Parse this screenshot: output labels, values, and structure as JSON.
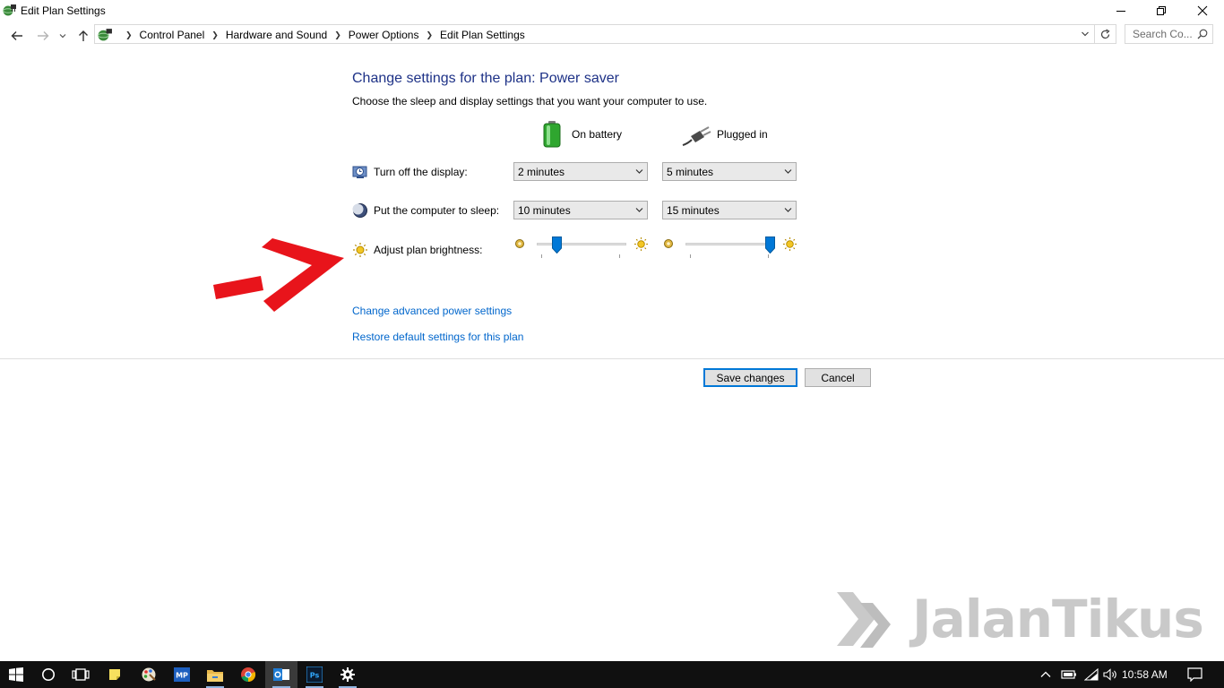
{
  "window": {
    "title": "Edit Plan Settings",
    "icon": "power-options-icon"
  },
  "window_controls": [
    "minimize-icon",
    "restore-icon",
    "close-icon"
  ],
  "navigation": {
    "buttons": [
      "back-arrow-icon",
      "forward-arrow-icon",
      "recent-dropdown-icon",
      "up-arrow-icon"
    ],
    "breadcrumb": [
      "Control Panel",
      "Hardware and Sound",
      "Power Options",
      "Edit Plan Settings"
    ],
    "search_placeholder": "Search Co..."
  },
  "content": {
    "heading": "Change settings for the plan: Power saver",
    "subheading": "Choose the sleep and display settings that you want your computer to use.",
    "columns": {
      "on_battery": "On battery",
      "plugged_in": "Plugged in"
    },
    "rows": {
      "display": {
        "label": "Turn off the display:",
        "on_battery": "2 minutes",
        "plugged_in": "5 minutes"
      },
      "sleep": {
        "label": "Put the computer to sleep:",
        "on_battery": "10 minutes",
        "plugged_in": "15 minutes"
      },
      "brightness": {
        "label": "Adjust plan brightness:",
        "on_battery_level": 0.2,
        "plugged_in_level": 1.0
      }
    },
    "links": {
      "advanced": "Change advanced power settings",
      "restore": "Restore default settings for this plan"
    },
    "buttons": {
      "save": "Save changes",
      "cancel": "Cancel"
    }
  },
  "colors": {
    "heading": "#1e3287",
    "link": "#0066cc",
    "accent": "#0078d7",
    "annotation_arrow": "#e8141b",
    "taskbar": "#101010"
  },
  "watermark": {
    "text": "JalanTikus"
  },
  "taskbar": {
    "items": [
      "windows-start-icon",
      "cortana-search-icon",
      "task-view-icon",
      "sticky-notes-icon",
      "paint-app-icon",
      "mp-app-icon",
      "file-explorer-icon",
      "chrome-icon",
      "outlook-icon",
      "photoshop-icon",
      "settings-gear-icon"
    ],
    "tray_icons": [
      "show-hidden-icons-chevron-icon",
      "battery-icon",
      "wifi-icon",
      "volume-icon"
    ],
    "time": "10:58 AM"
  }
}
